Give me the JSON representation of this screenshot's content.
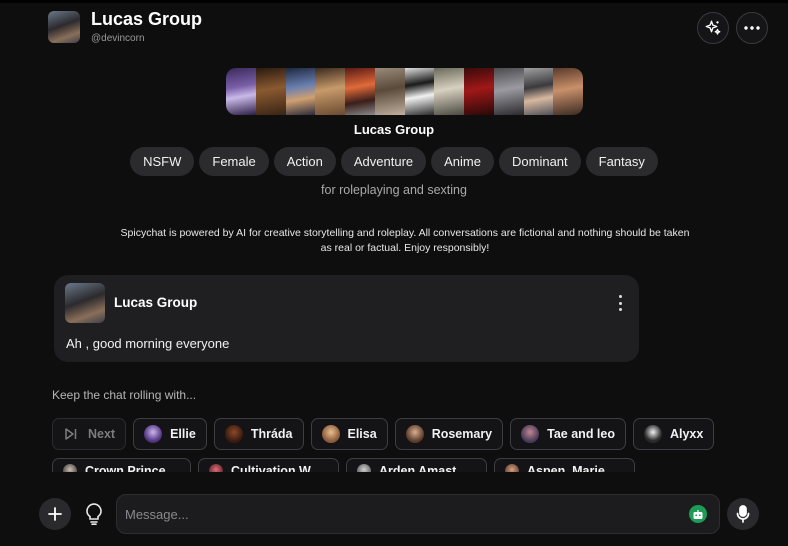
{
  "header": {
    "title": "Lucas Group",
    "handle": "@devincorn",
    "sparkle_icon": "sparkle-icon",
    "more_icon": "more-horizontal-icon"
  },
  "profile": {
    "name": "Lucas Group",
    "tags": [
      "NSFW",
      "Female",
      "Action",
      "Adventure",
      "Anime",
      "Dominant",
      "Fantasy"
    ],
    "tagline": "for roleplaying and sexting",
    "disclaimer": "Spicychat is powered by AI for creative storytelling and roleplay. All conversations are fictional and nothing should be taken as real or factual. Enjoy responsibly!"
  },
  "message": {
    "sender": "Lucas Group",
    "text": "Ah , good morning everyone"
  },
  "suggestions": {
    "heading": "Keep the chat rolling with...",
    "next_label": "Next",
    "row1": [
      "Ellie",
      "Thráda",
      "Elisa",
      "Rosemary",
      "Tae and leo",
      "Alyxx"
    ],
    "row2": [
      "Crown Prince...",
      "Cultivation W...",
      "Arden Amast...",
      "Aspen, Marie..."
    ]
  },
  "composer": {
    "placeholder": "Message...",
    "add_icon": "plus-icon",
    "bulb_icon": "lightbulb-icon",
    "model_icon": "bot-icon",
    "mic_icon": "microphone-icon"
  },
  "colors": {
    "background": "#0e0e0f",
    "card": "#1f1f21",
    "tag": "#2b2b2e",
    "model_badge": "#1e9c55"
  }
}
